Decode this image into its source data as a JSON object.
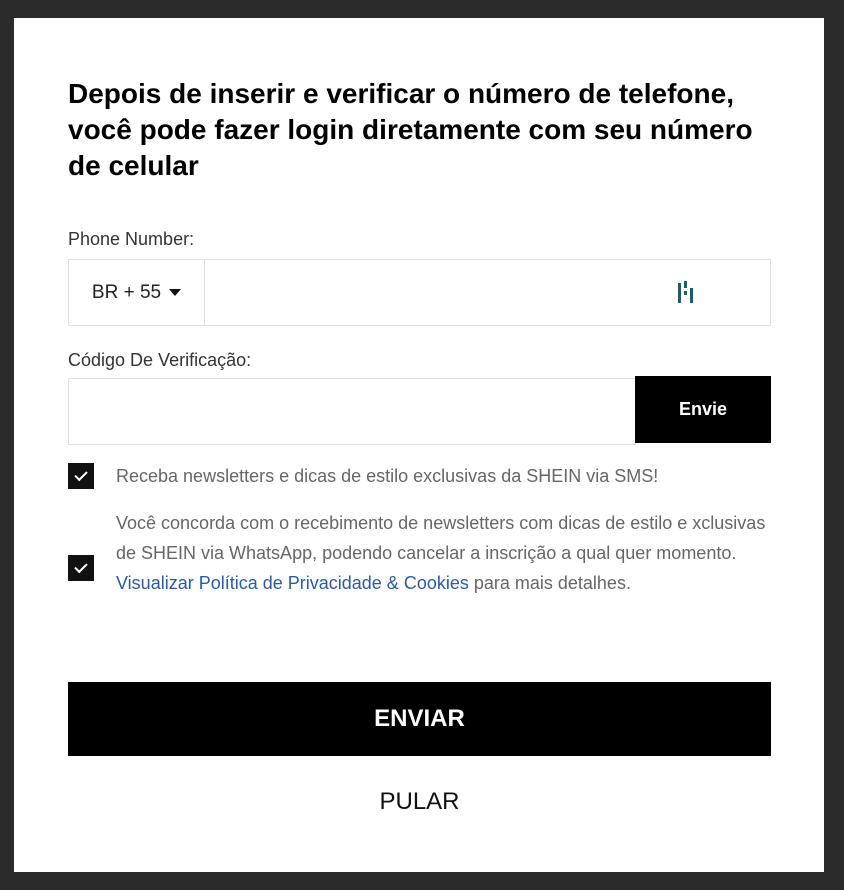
{
  "modal": {
    "title": "Depois de inserir e verificar o número de telefone, você pode fazer login diretamente com seu número de celular"
  },
  "phone": {
    "label": "Phone Number:",
    "country_code": "BR + 55",
    "value": "",
    "icon": "password-manager-icon"
  },
  "verification": {
    "label": "Código De Verificação:",
    "value": "",
    "send_label": "Envie"
  },
  "consents": {
    "sms": {
      "checked": true,
      "text": "Receba newsletters e dicas de estilo exclusivas da SHEIN via SMS!"
    },
    "whatsapp": {
      "checked": true,
      "text_before": "Você concorda com o recebimento de newsletters com dicas de estilo e xclusivas de SHEIN via WhatsApp, podendo cancelar a inscrição a qual quer momento. ",
      "link_text": "Visualizar Política de Privacidade & Cookies",
      "text_after": " para mais detalhes."
    }
  },
  "actions": {
    "submit_label": "ENVIAR",
    "skip_label": "PULAR"
  },
  "colors": {
    "overlay": "#2b2b2b",
    "primary": "#000000",
    "link": "#2b5aa1",
    "icon_accent": "#1f5c6b"
  }
}
